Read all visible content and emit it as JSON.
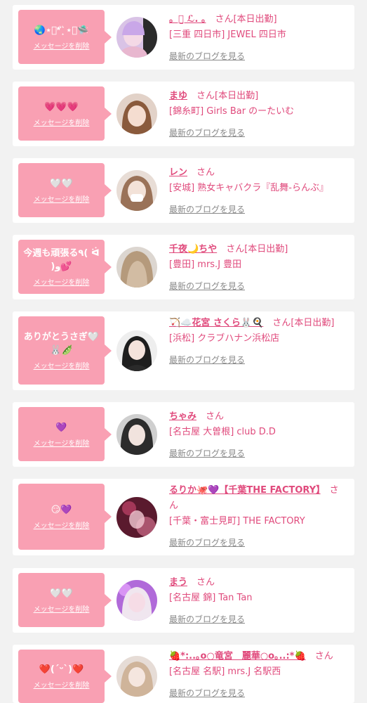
{
  "delete_label": "メッセージを削除",
  "blog_label": "最新のブログを見る",
  "honorific": "さん",
  "colors": {
    "accent": "#e04a7c",
    "bubble": "#f9a0b3",
    "background": "#f2f2f2",
    "card": "#ffffff"
  },
  "items": [
    {
      "message": "🌏⋆͛*͛ ͙͛ ⋆͛🛸",
      "name": "。ꪔ̤̮ ℒ. 。",
      "status": "[本日出勤]",
      "shop": "[三重 四日市] JEWEL 四日市"
    },
    {
      "message": "💗💗💗",
      "name": "まゆ",
      "status": "[本日出勤]",
      "shop": "[錦糸町] Girls Bar のーたいむ"
    },
    {
      "message": "🤍🤍",
      "name": "レン",
      "status": "",
      "shop": "[安城] 熟女キャバクラ『乱舞-らんぶ』"
    },
    {
      "message": "今週も頑張る٩( ᐛ )و💕",
      "name": "千夜🌙ちや",
      "status": "[本日出勤]",
      "shop": "[豊田] mrs.J 豊田"
    },
    {
      "message": "ありがとうさぎ🤍🐰🫛",
      "name": "🏹☁️花宮 さくら🐰🍳",
      "status": "[本日出勤]",
      "shop": "[浜松] クラブハナン浜松店"
    },
    {
      "message": "💜",
      "name": "ちゃみ",
      "status": "",
      "shop": "[名古屋 大曽根] club D.D"
    },
    {
      "message": "😏💜",
      "name": "るりか🐙💜【千葉THE FACTORY】",
      "status": "",
      "shop": "[千葉・富士見町] THE FACTORY"
    },
    {
      "message": "🤍🤍",
      "name": "まう",
      "status": "",
      "shop": "[名古屋 錦] Tan Tan"
    },
    {
      "message": "❤️(ˊᵕˋ)❤️",
      "name": "🍓*:..｡o○竜宮　麗華○o｡..:*🍓",
      "status": "",
      "shop": "[名古屋 名駅] mrs.J 名駅西"
    }
  ]
}
